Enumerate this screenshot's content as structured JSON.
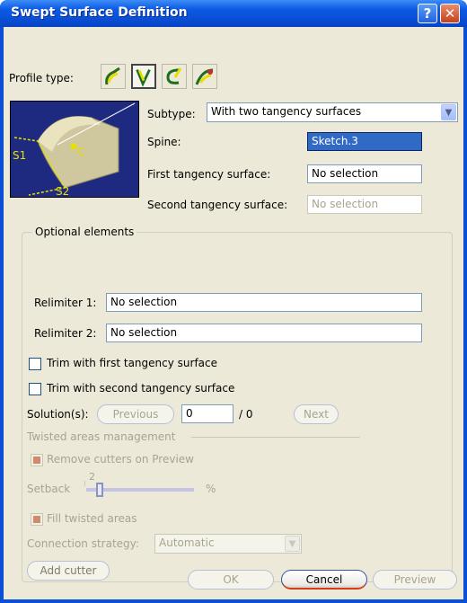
{
  "window": {
    "title": "Swept Surface Definition",
    "help_glyph": "?",
    "close_glyph": "✕"
  },
  "profile_type": {
    "label": "Profile type:",
    "selected_index": 1
  },
  "preview_image": {
    "labels": [
      "S1",
      "C",
      "S2"
    ]
  },
  "subtype": {
    "label": "Subtype:",
    "value": "With two tangency surfaces"
  },
  "spine": {
    "label": "Spine:",
    "value": "Sketch.3"
  },
  "first_tangency": {
    "label": "First tangency surface:",
    "value": "No selection"
  },
  "second_tangency": {
    "label": "Second tangency surface:",
    "value": "No selection"
  },
  "optional": {
    "legend": "Optional elements",
    "relimiter1": {
      "label": "Relimiter 1:",
      "value": "No selection"
    },
    "relimiter2": {
      "label": "Relimiter 2:",
      "value": "No selection"
    }
  },
  "trim_first": {
    "label": "Trim with first tangency surface",
    "checked": false
  },
  "trim_second": {
    "label": "Trim with second tangency surface",
    "checked": false
  },
  "solutions": {
    "label": "Solution(s):",
    "previous_label": "Previous",
    "current": "0",
    "total": "/ 0",
    "next_label": "Next"
  },
  "twisted": {
    "legend": "Twisted areas management",
    "remove_cutters": "Remove cutters on Preview",
    "setback_label": "Setback",
    "setback_value": "2",
    "setback_unit": "%",
    "setback_level": 0.1,
    "fill_twisted": "Fill twisted areas",
    "connection_label": "Connection strategy:",
    "connection_value": "Automatic",
    "add_cutter_label": "Add cutter"
  },
  "footer": {
    "ok_label": "OK",
    "cancel_label": "Cancel",
    "preview_label": "Preview"
  },
  "colors": {
    "title_bar": "#0a4fd6",
    "dialog_bg": "#ece9d8",
    "selection": "#316ac5",
    "disabled_text": "#a7a48f"
  }
}
